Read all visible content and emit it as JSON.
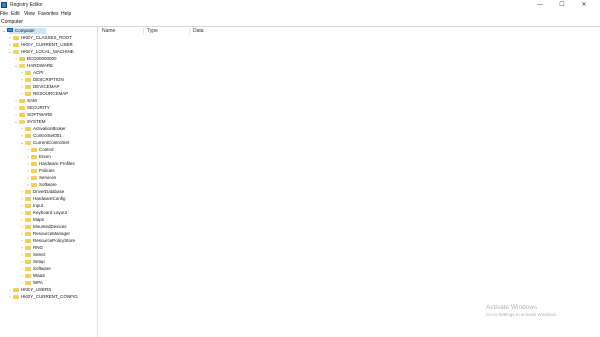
{
  "window": {
    "title": "Registry Editor",
    "controls": {
      "minimize": "—",
      "maximize": "☐",
      "close": "✕"
    }
  },
  "menu": [
    "File",
    "Edit",
    "View",
    "Favorites",
    "Help"
  ],
  "address": "Computer",
  "columns": {
    "name": "Name",
    "type": "Type",
    "data": "Data"
  },
  "tree": [
    {
      "label": "Computer",
      "depth": 0,
      "expanded": true,
      "selected": true,
      "icon": "computer-icon"
    },
    {
      "label": "HKEY_CLASSES_ROOT",
      "depth": 1,
      "expanded": false
    },
    {
      "label": "HKEY_CURRENT_USER",
      "depth": 1,
      "expanded": false
    },
    {
      "label": "HKEY_LOCAL_MACHINE",
      "depth": 1,
      "expanded": true
    },
    {
      "label": "BCD00000000",
      "depth": 2,
      "expanded": false
    },
    {
      "label": "HARDWARE",
      "depth": 2,
      "expanded": true
    },
    {
      "label": "ACPI",
      "depth": 3,
      "expanded": false
    },
    {
      "label": "DESCRIPTION",
      "depth": 3,
      "expanded": false
    },
    {
      "label": "DEVICEMAP",
      "depth": 3,
      "expanded": false
    },
    {
      "label": "RESOURCEMAP",
      "depth": 3,
      "expanded": false
    },
    {
      "label": "SAM",
      "depth": 2,
      "expanded": false
    },
    {
      "label": "SECURITY",
      "depth": 2,
      "expanded": false
    },
    {
      "label": "SOFTWARE",
      "depth": 2,
      "expanded": false
    },
    {
      "label": "SYSTEM",
      "depth": 2,
      "expanded": true
    },
    {
      "label": "ActivationBroker",
      "depth": 3,
      "expanded": false
    },
    {
      "label": "ControlSet001",
      "depth": 3,
      "expanded": false
    },
    {
      "label": "CurrentControlSet",
      "depth": 3,
      "expanded": true
    },
    {
      "label": "Control",
      "depth": 4,
      "expanded": false
    },
    {
      "label": "Enum",
      "depth": 4,
      "expanded": false
    },
    {
      "label": "Hardware Profiles",
      "depth": 4,
      "expanded": false
    },
    {
      "label": "Policies",
      "depth": 4,
      "expanded": false
    },
    {
      "label": "Services",
      "depth": 4,
      "expanded": false
    },
    {
      "label": "Software",
      "depth": 4,
      "expanded": false
    },
    {
      "label": "DriverDatabase",
      "depth": 3,
      "expanded": false
    },
    {
      "label": "HardwareConfig",
      "depth": 3,
      "expanded": false
    },
    {
      "label": "Input",
      "depth": 3,
      "expanded": false
    },
    {
      "label": "Keyboard Layout",
      "depth": 3,
      "expanded": false
    },
    {
      "label": "Maps",
      "depth": 3,
      "expanded": false
    },
    {
      "label": "MountedDevices",
      "depth": 3,
      "expanded": false
    },
    {
      "label": "ResourceManager",
      "depth": 3,
      "expanded": false
    },
    {
      "label": "ResourcePolicyStore",
      "depth": 3,
      "expanded": false
    },
    {
      "label": "RNG",
      "depth": 3,
      "expanded": false
    },
    {
      "label": "Select",
      "depth": 3,
      "expanded": false
    },
    {
      "label": "Setup",
      "depth": 3,
      "expanded": false
    },
    {
      "label": "Software",
      "depth": 3,
      "expanded": false
    },
    {
      "label": "WaaS",
      "depth": 3,
      "expanded": false
    },
    {
      "label": "WPA",
      "depth": 3,
      "expanded": false
    },
    {
      "label": "HKEY_USERS",
      "depth": 1,
      "expanded": false
    },
    {
      "label": "HKEY_CURRENT_CONFIG",
      "depth": 1,
      "expanded": false
    }
  ],
  "watermark": {
    "title": "Activate Windows",
    "subtitle": "Go to Settings to activate Windows."
  },
  "colors": {
    "selection": "#cce4f7",
    "folder": "#f3cf58",
    "watermark": "#b0b0b0"
  }
}
